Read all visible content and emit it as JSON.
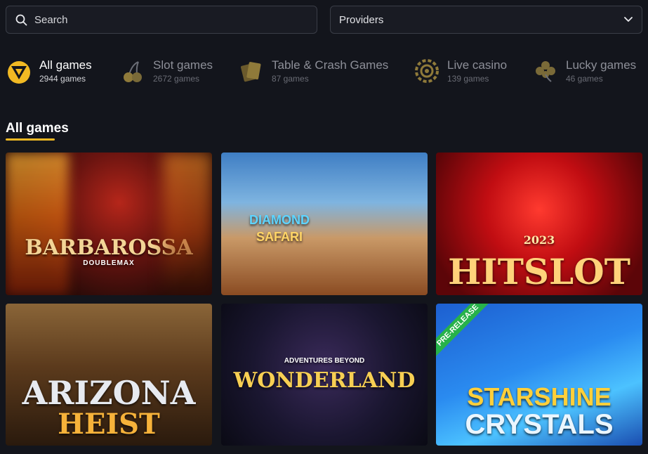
{
  "search": {
    "placeholder": "Search"
  },
  "providers": {
    "label": "Providers"
  },
  "categories": [
    {
      "name": "All games",
      "count": "2944 games",
      "icon": "all-games-icon"
    },
    {
      "name": "Slot games",
      "count": "2672 games",
      "icon": "cherries-icon"
    },
    {
      "name": "Table & Crash Games",
      "count": "87 games",
      "icon": "cards-icon"
    },
    {
      "name": "Live casino",
      "count": "139 games",
      "icon": "roulette-icon"
    },
    {
      "name": "Lucky games",
      "count": "46 games",
      "icon": "clover-icon"
    }
  ],
  "section": {
    "title": "All games"
  },
  "games": [
    {
      "title": "BARBAROSSA",
      "subtitle": "DOUBLEMAX"
    },
    {
      "title": "DIAMOND",
      "subtitle": "SAFARI"
    },
    {
      "title": "HITSLOT",
      "subtitle": "2023"
    },
    {
      "title": "ARIZONA",
      "subtitle": "HEIST"
    },
    {
      "title": "WONDERLAND",
      "subtitle": "ADVENTURES BEYOND"
    },
    {
      "title": "STARSHINE",
      "subtitle": "CRYSTALS",
      "badge": "PRE-RELEASE"
    }
  ],
  "colors": {
    "accent": "#f1b923",
    "background": "#13151c",
    "prerelease": "#27b24a"
  }
}
